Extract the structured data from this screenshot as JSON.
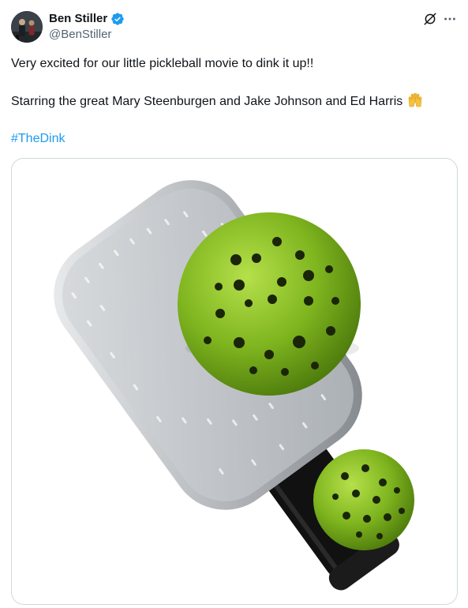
{
  "author": {
    "display_name": "Ben Stiller",
    "handle": "@BenStiller",
    "verified": true,
    "avatar_icon": "profile-photo"
  },
  "tweet": {
    "line1": "Very excited for our little pickleball movie to dink it up!!",
    "line2": "Starring the great Mary Steenburgen and Jake Johnson and Ed Harris",
    "emoji": "raising-hands",
    "hashtag": "#TheDink"
  },
  "actions": {
    "grok_icon": "grok-icon",
    "more_icon": "more-dots-icon"
  },
  "media": {
    "description_icon": "pickleball-paddle-and-balls",
    "paddle_color": "#b8bcc0",
    "ball_color": "#7fb51f",
    "handle_color": "#111111"
  },
  "colors": {
    "link": "#1d9bf0",
    "secondary_text": "#536471",
    "verified": "#1d9bf0"
  }
}
